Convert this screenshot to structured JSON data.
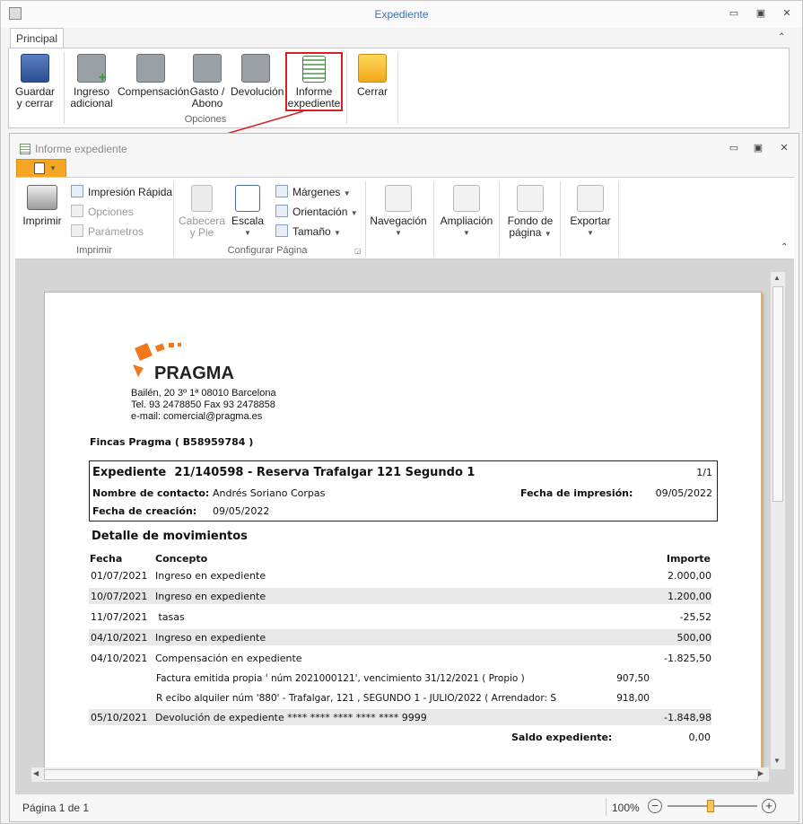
{
  "window": {
    "title": "Expediente"
  },
  "outer_tabs": [
    "Principal"
  ],
  "outer_ribbon": {
    "buttons": [
      {
        "line1": "Guardar",
        "line2": "y cerrar",
        "icon": "save-icon"
      },
      {
        "line1": "Ingreso",
        "line2": "adicional",
        "icon": "safe-add-icon"
      },
      {
        "line1": "Compensación",
        "line2": "",
        "icon": "safe-exchange-icon"
      },
      {
        "line1": "Gasto /",
        "line2": "Abono",
        "icon": "safe-coins-icon"
      },
      {
        "line1": "Devolución",
        "line2": "",
        "icon": "safe-return-icon"
      },
      {
        "line1": "Informe",
        "line2": "expediente",
        "icon": "report-icon"
      },
      {
        "line1": "Cerrar",
        "line2": "",
        "icon": "folder-close-icon"
      }
    ],
    "group_label": "Opciones"
  },
  "inner_window": {
    "title": "Informe expediente"
  },
  "inner_ribbon": {
    "imprimir": {
      "big": "Imprimir",
      "items": [
        "Impresión Rápida",
        "Opciones",
        "Parámetros"
      ],
      "group": "Imprimir"
    },
    "configurar": {
      "cabecera1": "Cabecera",
      "cabecera2": "y Pie",
      "escala": "Escala",
      "items": [
        "Márgenes",
        "Orientación",
        "Tamaño"
      ],
      "group": "Configurar Página"
    },
    "navegacion": "Navegación",
    "ampliacion": "Ampliación",
    "fondo1": "Fondo de",
    "fondo2": "página",
    "exportar": "Exportar"
  },
  "document": {
    "logo_text": "PRAGMA",
    "address": [
      "Bailén, 20 3º 1ª 08010 Barcelona",
      "Tel. 93 2478850 Fax 93 2478858",
      "e-mail: comercial@pragma.es"
    ],
    "company": "Fincas Pragma ( B58959784 )",
    "expediente_label": "Expediente",
    "expediente_title": "21/140598 - Reserva Trafalgar 121 Segundo 1",
    "page_count": "1/1",
    "contact_label": "Nombre de contacto:",
    "contact_value": "Andrés Soriano Corpas",
    "print_date_label": "Fecha de impresión:",
    "print_date_value": "09/05/2022",
    "creation_label": "Fecha de creación:",
    "creation_value": "09/05/2022",
    "section_title": "Detalle de movimientos",
    "headers": {
      "fecha": "Fecha",
      "concepto": "Concepto",
      "importe": "Importe"
    },
    "rows": [
      {
        "fecha": "01/07/2021",
        "concepto": "Ingreso en expediente",
        "importe": "2.000,00",
        "shade": false
      },
      {
        "fecha": "10/07/2021",
        "concepto": "Ingreso en expediente",
        "importe": "1.200,00",
        "shade": true
      },
      {
        "fecha": "11/07/2021",
        "concepto": " tasas",
        "importe": "-25,52",
        "shade": false
      },
      {
        "fecha": "04/10/2021",
        "concepto": "Ingreso en expediente",
        "importe": "500,00",
        "shade": true
      },
      {
        "fecha": "04/10/2021",
        "concepto": "Compensación en expediente",
        "importe": "-1.825,50",
        "shade": false
      }
    ],
    "subrows": [
      {
        "text": "Factura emitida propia ' núm 2021000121', vencimiento 31/12/2021 ( Propio )",
        "amount": "907,50"
      },
      {
        "text": "R ecibo alquiler núm '880' - Trafalgar, 121 , SEGUNDO 1 - JULIO/2022 ( Arrendador: S",
        "amount": "918,00"
      }
    ],
    "last_row": {
      "fecha": "05/10/2021",
      "concepto": "Devolución de expediente **** **** **** **** **** 9999",
      "importe": "-1.848,98"
    },
    "saldo_label": "Saldo expediente:",
    "saldo_value": "0,00"
  },
  "status_bar": {
    "page": "Página 1 de 1",
    "zoom": "100%",
    "zoom_level_fraction": 0.5
  },
  "colors": {
    "accent_orange": "#f6a623",
    "title_blue": "#3d6fb0",
    "highlight_red": "#d92020",
    "pragma_orange": "#f07a1a"
  }
}
